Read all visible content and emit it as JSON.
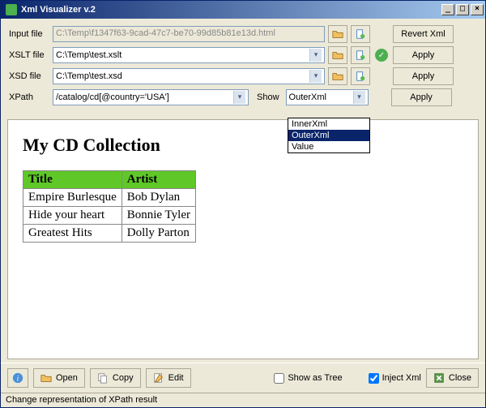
{
  "window": {
    "title": "Xml Visualizer v.2"
  },
  "labels": {
    "input_file": "Input file",
    "xslt_file": "XSLT file",
    "xsd_file": "XSD file",
    "xpath": "XPath",
    "show": "Show"
  },
  "fields": {
    "input_file_value": "C:\\Temp\\f1347f63-9cad-47c7-be70-99d85b81e13d.html",
    "xslt_file_value": "C:\\Temp\\test.xslt",
    "xsd_file_value": "C:\\Temp\\test.xsd",
    "xpath_value": "/catalog/cd[@country='USA']",
    "show_value": "OuterXml",
    "show_options": [
      "InnerXml",
      "OuterXml",
      "Value"
    ]
  },
  "buttons": {
    "revert_xml": "Revert Xml",
    "apply": "Apply",
    "open": "Open",
    "copy": "Copy",
    "edit": "Edit",
    "close": "Close"
  },
  "checkboxes": {
    "show_as_tree": "Show as Tree",
    "inject_xml": "Inject Xml",
    "show_as_tree_checked": false,
    "inject_xml_checked": true
  },
  "document": {
    "heading": "My CD Collection",
    "headers": [
      "Title",
      "Artist"
    ],
    "rows": [
      [
        "Empire Burlesque",
        "Bob Dylan"
      ],
      [
        "Hide your heart",
        "Bonnie Tyler"
      ],
      [
        "Greatest Hits",
        "Dolly Parton"
      ]
    ]
  },
  "status": "Change representation of XPath result"
}
